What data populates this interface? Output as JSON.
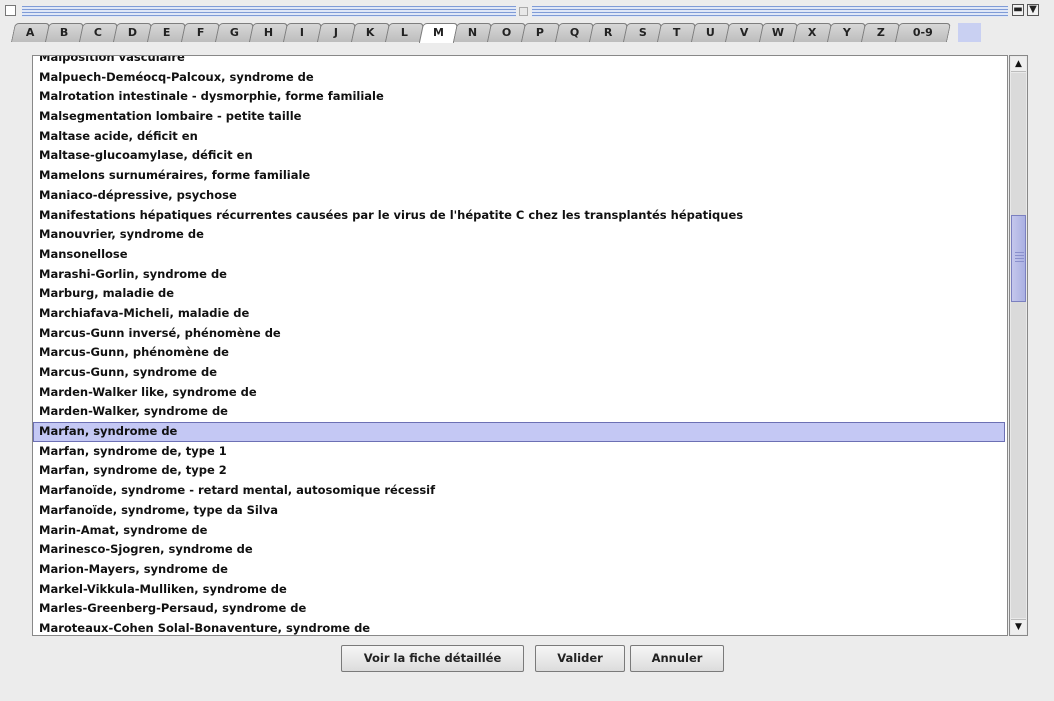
{
  "tabs": [
    {
      "label": "A"
    },
    {
      "label": "B"
    },
    {
      "label": "C"
    },
    {
      "label": "D"
    },
    {
      "label": "E"
    },
    {
      "label": "F"
    },
    {
      "label": "G"
    },
    {
      "label": "H"
    },
    {
      "label": "I"
    },
    {
      "label": "J"
    },
    {
      "label": "K"
    },
    {
      "label": "L"
    },
    {
      "label": "M",
      "active": true
    },
    {
      "label": "N"
    },
    {
      "label": "O"
    },
    {
      "label": "P"
    },
    {
      "label": "Q"
    },
    {
      "label": "R"
    },
    {
      "label": "S"
    },
    {
      "label": "T"
    },
    {
      "label": "U"
    },
    {
      "label": "V"
    },
    {
      "label": "W"
    },
    {
      "label": "X"
    },
    {
      "label": "Y"
    },
    {
      "label": "Z"
    },
    {
      "label": "0-9"
    }
  ],
  "list": {
    "selected": "Marfan, syndrome de",
    "items": [
      "Malposition vasculaire",
      "Malpuech-Deméocq-Palcoux, syndrome de",
      "Malrotation intestinale - dysmorphie, forme familiale",
      "Malsegmentation lombaire - petite taille",
      "Maltase acide, déficit en",
      "Maltase-glucoamylase, déficit en",
      "Mamelons surnuméraires, forme familiale",
      "Maniaco-dépressive, psychose",
      "Manifestations hépatiques récurrentes causées par le virus de l'hépatite C chez les transplantés hépatiques",
      "Manouvrier, syndrome de",
      "Mansonellose",
      "Marashi-Gorlin, syndrome de",
      "Marburg, maladie de",
      "Marchiafava-Micheli, maladie de",
      "Marcus-Gunn inversé, phénomène de",
      "Marcus-Gunn, phénomène de",
      "Marcus-Gunn, syndrome de",
      "Marden-Walker like, syndrome de",
      "Marden-Walker, syndrome de",
      "Marfan, syndrome de",
      "Marfan, syndrome de, type 1",
      "Marfan, syndrome de, type 2",
      "Marfanoïde, syndrome - retard mental, autosomique récessif",
      "Marfanoïde, syndrome, type da Silva",
      "Marin-Amat, syndrome de",
      "Marinesco-Sjogren, syndrome de",
      "Marion-Mayers, syndrome de",
      "Markel-Vikkula-Mulliken, syndrome de",
      "Marles-Greenberg-Persaud, syndrome de",
      "Maroteaux-Cohen Solal-Bonaventure, syndrome de"
    ]
  },
  "scroll_position": 0.31,
  "buttons": {
    "detail": "Voir la fiche détaillée",
    "validate": "Valider",
    "cancel": "Annuler"
  },
  "colors": {
    "selection": "#c4c8f4",
    "accent": "#7f9bd6"
  }
}
